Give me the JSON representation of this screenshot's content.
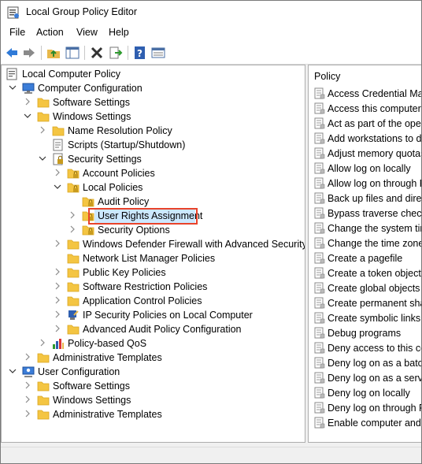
{
  "window": {
    "title": "Local Group Policy Editor"
  },
  "menu": [
    "File",
    "Action",
    "View",
    "Help"
  ],
  "toolbar": {
    "buttons": [
      "back-icon",
      "forward-icon",
      "up-folder-icon",
      "show-hide-tree-icon",
      "delete-icon",
      "export-list-icon",
      "help-icon",
      "properties-icon"
    ]
  },
  "tree": {
    "items": [
      {
        "label": "Local Computer Policy",
        "level": 0,
        "icon": "computer-policy-icon",
        "chevron": "none"
      },
      {
        "label": "Computer Configuration",
        "level": 0,
        "icon": "computer-icon",
        "chevron": "expanded"
      },
      {
        "label": "Software Settings",
        "level": 1,
        "icon": "folder-icon",
        "chevron": "collapsed"
      },
      {
        "label": "Windows Settings",
        "level": 1,
        "icon": "folder-icon",
        "chevron": "expanded"
      },
      {
        "label": "Name Resolution Policy",
        "level": 2,
        "icon": "folder-icon",
        "chevron": "collapsed"
      },
      {
        "label": "Scripts (Startup/Shutdown)",
        "level": 2,
        "icon": "scripts-icon",
        "chevron": "none"
      },
      {
        "label": "Security Settings",
        "level": 2,
        "icon": "security-settings-icon",
        "chevron": "expanded"
      },
      {
        "label": "Account Policies",
        "level": 3,
        "icon": "locked-folder-icon",
        "chevron": "collapsed"
      },
      {
        "label": "Local Policies",
        "level": 3,
        "icon": "locked-folder-icon",
        "chevron": "expanded"
      },
      {
        "label": "Audit Policy",
        "level": 4,
        "icon": "locked-folder-icon",
        "chevron": "none"
      },
      {
        "label": "User Rights Assignment",
        "level": 4,
        "icon": "locked-folder-icon",
        "chevron": "collapsed",
        "selected": true
      },
      {
        "label": "Security Options",
        "level": 4,
        "icon": "locked-folder-icon",
        "chevron": "collapsed"
      },
      {
        "label": "Windows Defender Firewall with Advanced Security",
        "level": 3,
        "icon": "folder-icon",
        "chevron": "collapsed"
      },
      {
        "label": "Network List Manager Policies",
        "level": 3,
        "icon": "folder-icon",
        "chevron": "none"
      },
      {
        "label": "Public Key Policies",
        "level": 3,
        "icon": "folder-icon",
        "chevron": "collapsed"
      },
      {
        "label": "Software Restriction Policies",
        "level": 3,
        "icon": "folder-icon",
        "chevron": "collapsed"
      },
      {
        "label": "Application Control Policies",
        "level": 3,
        "icon": "folder-icon",
        "chevron": "collapsed"
      },
      {
        "label": "IP Security Policies on Local Computer",
        "level": 3,
        "icon": "ip-security-icon",
        "chevron": "collapsed"
      },
      {
        "label": "Advanced Audit Policy Configuration",
        "level": 3,
        "icon": "folder-icon",
        "chevron": "collapsed"
      },
      {
        "label": "Policy-based QoS",
        "level": 2,
        "icon": "qos-chart-icon",
        "chevron": "collapsed"
      },
      {
        "label": "Administrative Templates",
        "level": 1,
        "icon": "folder-icon",
        "chevron": "collapsed"
      },
      {
        "label": "User Configuration",
        "level": 0,
        "icon": "user-icon",
        "chevron": "expanded"
      },
      {
        "label": "Software Settings",
        "level": 1,
        "icon": "folder-icon",
        "chevron": "collapsed"
      },
      {
        "label": "Windows Settings",
        "level": 1,
        "icon": "folder-icon",
        "chevron": "collapsed"
      },
      {
        "label": "Administrative Templates",
        "level": 1,
        "icon": "folder-icon",
        "chevron": "collapsed"
      }
    ]
  },
  "list": {
    "header": "Policy",
    "items": [
      "Access Credential Mana",
      "Access this computer fr",
      "Act as part of the opera",
      "Add workstations to do",
      "Adjust memory quotas",
      "Allow log on locally",
      "Allow log on through R",
      "Back up files and direct",
      "Bypass traverse checkin",
      "Change the system tim",
      "Change the time zone",
      "Create a pagefile",
      "Create a token object",
      "Create global objects",
      "Create permanent shar",
      "Create symbolic links",
      "Debug programs",
      "Deny access to this cor",
      "Deny log on as a batch",
      "Deny log on as a servic",
      "Deny log on locally",
      "Deny log on through R",
      "Enable computer and u"
    ]
  },
  "colors": {
    "selection": "#cce8ff",
    "highlight_border": "#e8432b",
    "folder": "#f4c542"
  }
}
